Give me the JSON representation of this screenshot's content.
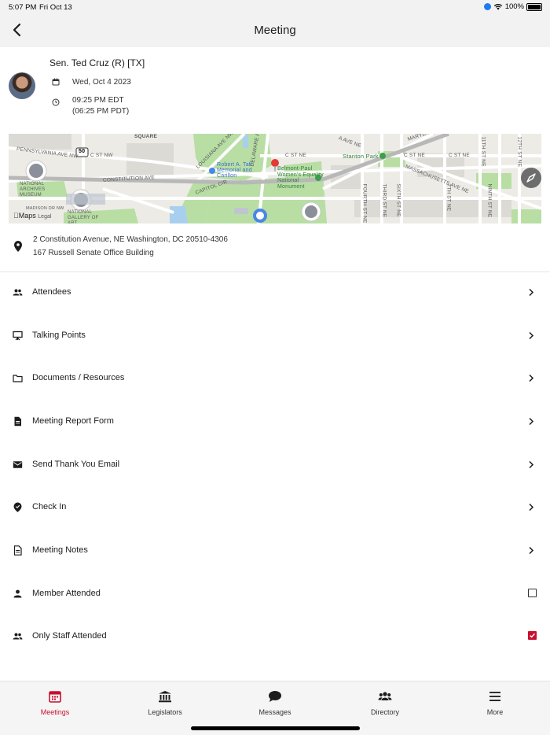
{
  "status_bar": {
    "time": "5:07 PM",
    "date": "Fri Oct 13",
    "battery": "100%"
  },
  "nav": {
    "title": "Meeting"
  },
  "meeting": {
    "legislator": "Sen. Ted Cruz (R) [TX]",
    "date": "Wed, Oct 4 2023",
    "time_local": "09:25 PM EDT",
    "time_alt": "(06:25 PM PDT)"
  },
  "map": {
    "labels": {
      "square": "SQUARE",
      "pennsylvania": "PENNSYLVANIA AVE NW",
      "c_st_nw": "C ST NW",
      "louisiana": "LOUISIANA AVE NW",
      "delaware": "DELAWARE AVE NE",
      "c_st_ne_1": "C ST NE",
      "c_st_ne_2": "C ST NE",
      "c_st_ne_3": "C ST NE",
      "a_ave": "A AVE NE",
      "maryland": "MARYLAND AVE NE",
      "massachusetts": "MASSACHUSETTS AVE NE",
      "taft": "Robert A. Taft Memorial and Carillon",
      "belmont": "Belmont-Paul Women's Equality National Monument",
      "stanton": "Stanton Park",
      "archives": "NATIONAL ARCHIVES MUSEUM",
      "gallery": "NATIONAL GALLERY OF ART",
      "constitution": "CONSTITUTION AVE",
      "capitol_cir": "CAPITOL CIR",
      "fourth": "FOURTH ST NE",
      "third": "THIRD ST NE",
      "sixth": "SIXTH ST NE",
      "seventh": "7TH ST NE",
      "eleventh": "11TH ST NE",
      "ninth": "NINTH ST NE",
      "twelfth": "12TH ST NE",
      "route": "50",
      "madison": "MADISON DR NW",
      "maps_brand": "Maps",
      "legal": "Legal"
    }
  },
  "address": {
    "line1": "2 Constitution Avenue, NE Washington, DC 20510-4306",
    "line2": "167 Russell Senate Office Building"
  },
  "menu": [
    {
      "label": "Attendees",
      "icon": "people-icon",
      "control": "chevron"
    },
    {
      "label": "Talking Points",
      "icon": "presentation-icon",
      "control": "chevron"
    },
    {
      "label": "Documents / Resources",
      "icon": "folder-icon",
      "control": "chevron"
    },
    {
      "label": "Meeting Report Form",
      "icon": "document-icon",
      "control": "chevron"
    },
    {
      "label": "Send Thank You Email",
      "icon": "email-icon",
      "control": "chevron"
    },
    {
      "label": "Check In",
      "icon": "location-check-icon",
      "control": "chevron"
    },
    {
      "label": "Meeting Notes",
      "icon": "notes-icon",
      "control": "chevron"
    },
    {
      "label": "Member Attended",
      "icon": "person-icon",
      "control": "checkbox",
      "checked": false
    },
    {
      "label": "Only Staff Attended",
      "icon": "people-icon",
      "control": "checkbox",
      "checked": true
    }
  ],
  "tabs": [
    {
      "label": "Meetings",
      "icon": "calendar-icon",
      "active": true
    },
    {
      "label": "Legislators",
      "icon": "capitol-icon",
      "active": false
    },
    {
      "label": "Messages",
      "icon": "chat-bubble-icon",
      "active": false
    },
    {
      "label": "Directory",
      "icon": "group-icon",
      "active": false
    },
    {
      "label": "More",
      "icon": "hamburger-menu-icon",
      "active": false
    }
  ],
  "colors": {
    "accent": "#c8102e",
    "park": "#b8dea4",
    "road": "#ffffff",
    "water": "#a9cfee"
  }
}
